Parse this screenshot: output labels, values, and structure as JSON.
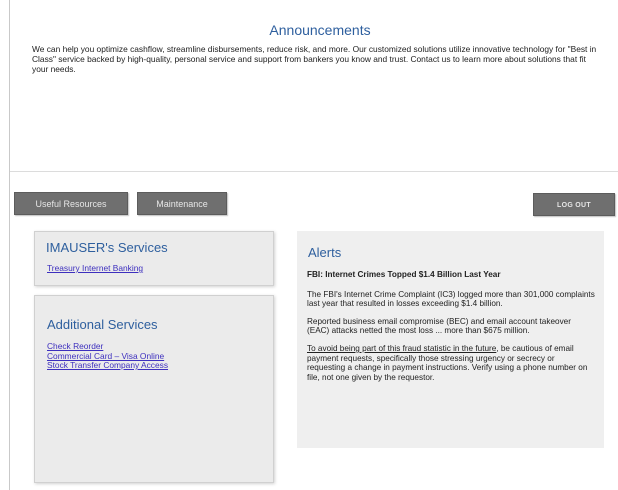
{
  "announcements": {
    "title": "Announcements",
    "body": "We can help you optimize cashflow, streamline disbursements, reduce risk, and more.  Our customized solutions utilize innovative technology for \"Best in Class\" service backed by high-quality, personal service and support from bankers you know and trust.  Contact us to learn more about solutions that fit your needs."
  },
  "toolbar": {
    "useful_resources": "Useful Resources",
    "maintenance": "Maintenance",
    "logout": "LOG OUT"
  },
  "services": {
    "title": "IMAUSER's Services",
    "links": [
      "Treasury Internet Banking"
    ]
  },
  "additional_services": {
    "title": "Additional Services",
    "links": [
      "Check Reorder",
      "Commercial Card – Visa Online",
      "Stock Transfer Company Access"
    ]
  },
  "alerts": {
    "title": "Alerts",
    "headline": "FBI: Internet Crimes Topped $1.4 Billion Last Year",
    "p1": "The FBI's Internet Crime Complaint (IC3) logged more than 301,000 complaints last year that resulted in losses exceeding $1.4 billion.",
    "p2": "Reported business email compromise (BEC) and email account takeover (EAC) attacks netted the most loss ... more than $675 million.",
    "p3_underlined": "To avoid being part of this fraud statistic in the future",
    "p3_rest": ", be cautious of email payment requests, specifically those stressing urgency or secrecy or requesting a change in payment instructions.  Verify using a phone number on file, not one given by the requestor."
  },
  "colors": {
    "heading_blue": "#2e5f9e",
    "link_purple": "#3d2fbe",
    "button_gray": "#6f6f6f",
    "panel_gray": "#ebebeb"
  }
}
